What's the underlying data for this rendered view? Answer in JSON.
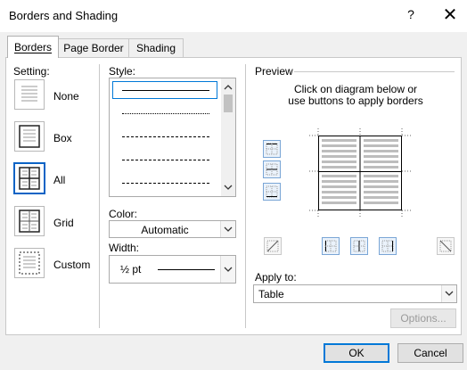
{
  "dialog": {
    "title": "Borders and Shading",
    "help": "?",
    "close": "✕"
  },
  "tabs": [
    {
      "label": "Borders",
      "active": true
    },
    {
      "label": "Page Border",
      "active": false
    },
    {
      "label": "Shading",
      "active": false
    }
  ],
  "setting": {
    "heading": "Setting:",
    "options": [
      {
        "label": "None",
        "selected": false
      },
      {
        "label": "Box",
        "selected": false
      },
      {
        "label": "All",
        "selected": true
      },
      {
        "label": "Grid",
        "selected": false
      },
      {
        "label": "Custom",
        "selected": false
      }
    ]
  },
  "style": {
    "heading": "Style:"
  },
  "color": {
    "heading": "Color:",
    "value": "Automatic"
  },
  "width": {
    "heading": "Width:",
    "value": "½ pt"
  },
  "preview": {
    "heading": "Preview",
    "instruction_line1": "Click on diagram below or",
    "instruction_line2": "use buttons to apply borders"
  },
  "apply_to": {
    "heading": "Apply to:",
    "value": "Table"
  },
  "buttons": {
    "options": "Options...",
    "ok": "OK",
    "cancel": "Cancel"
  },
  "colors": {
    "accent": "#0078d7",
    "selection": "#0b63c5"
  }
}
